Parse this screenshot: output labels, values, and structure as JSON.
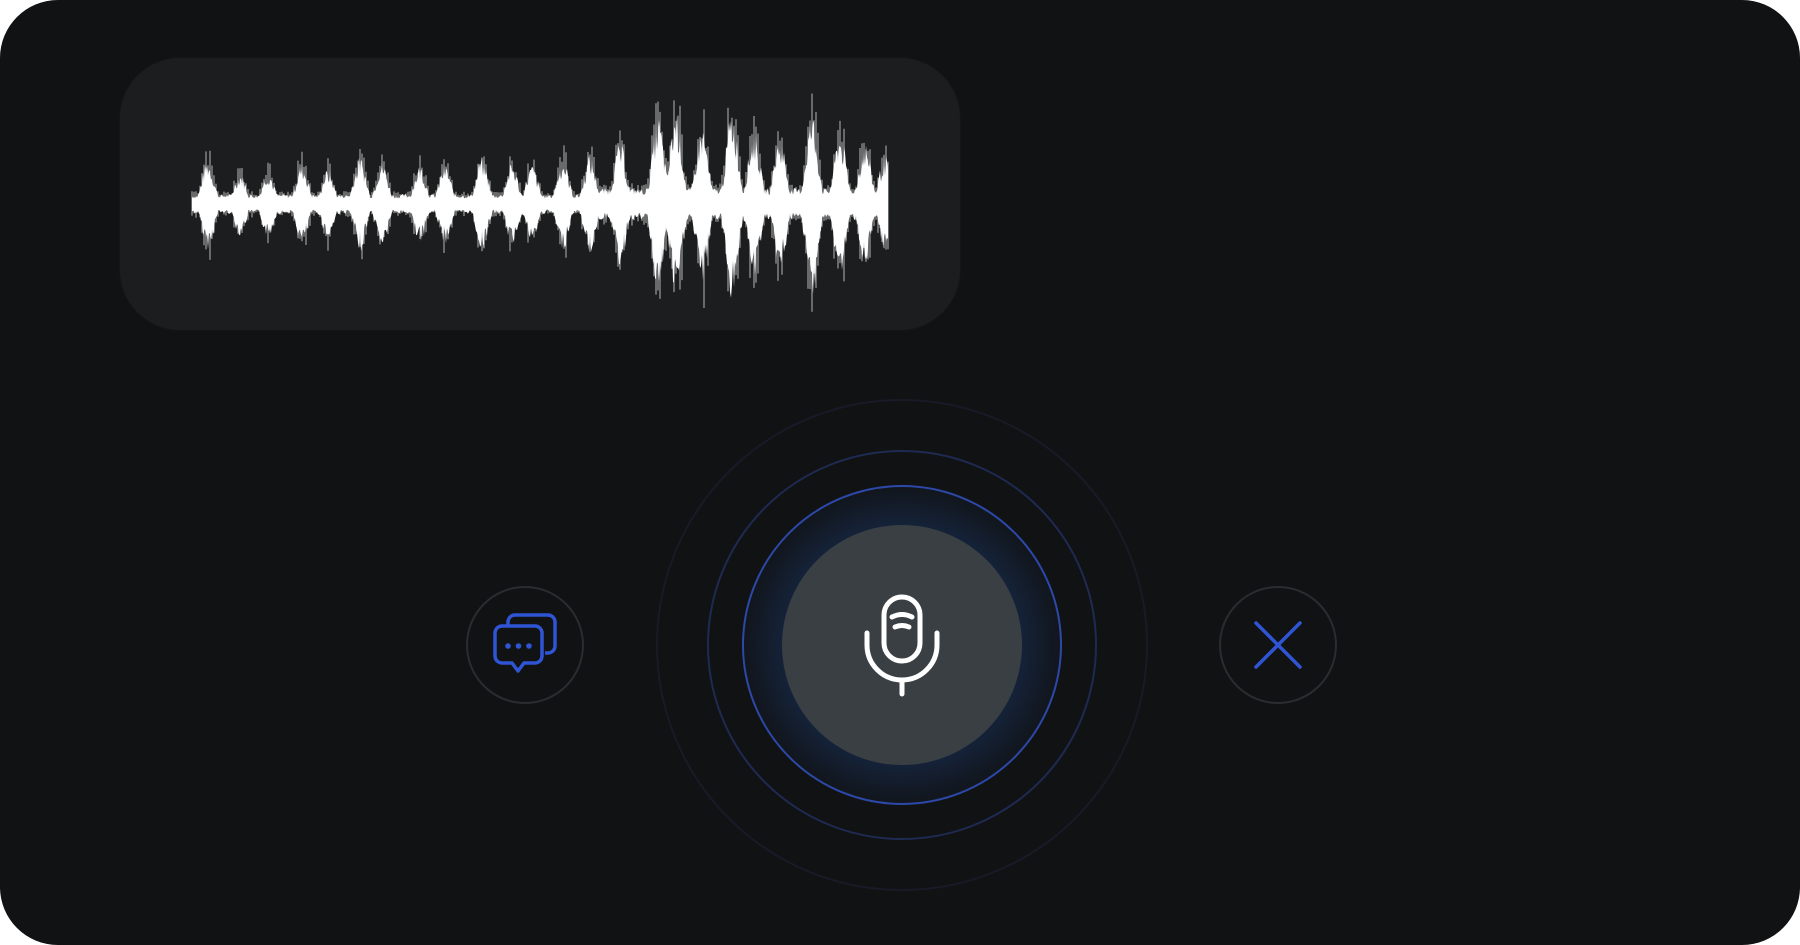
{
  "colors": {
    "background": "#111214",
    "card": "#1c1d1f",
    "mic_button": "#3a3f44",
    "accent_blue": "#2f55d4",
    "waveform": "#ffffff",
    "ring_dim": "#1d2236"
  },
  "voice_input": {
    "state": "listening",
    "mic_icon": "microphone-icon"
  },
  "actions": {
    "chat_icon": "chat-bubbles-icon",
    "close_icon": "close-icon"
  }
}
